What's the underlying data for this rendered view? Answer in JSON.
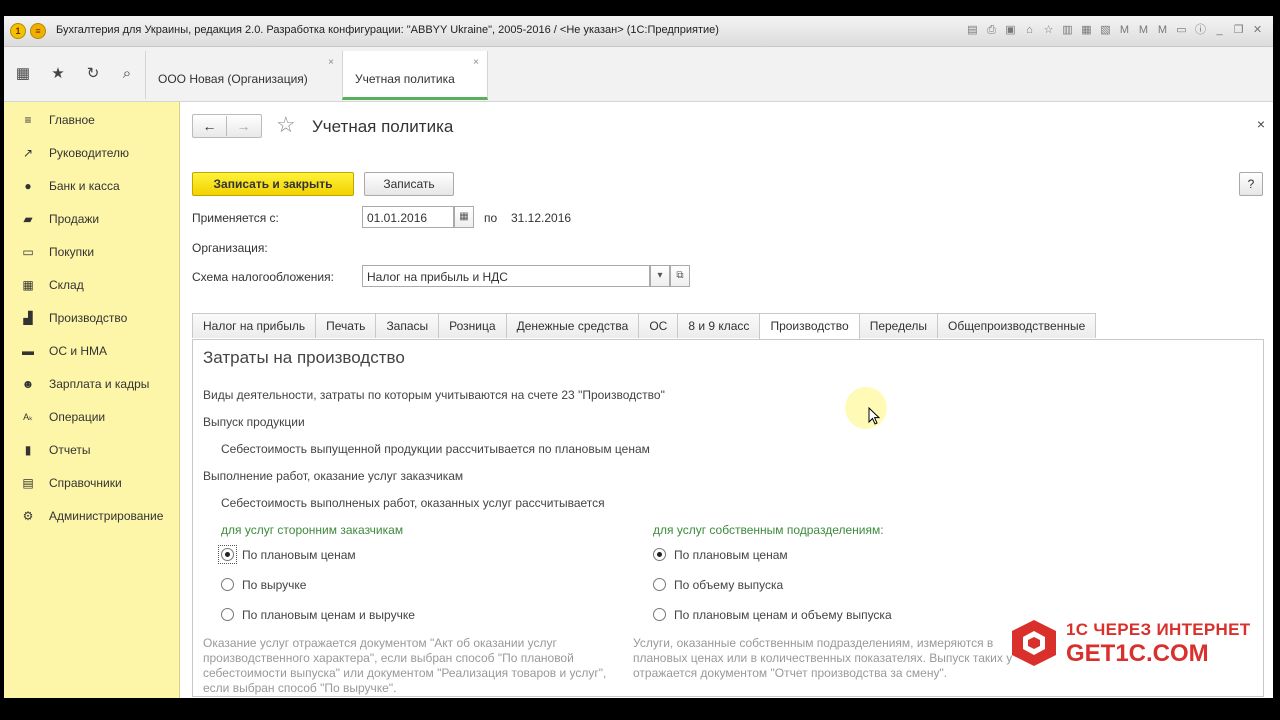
{
  "window": {
    "title": "Бухгалтерия для Украины, редакция 2.0. Разработка конфигурации: \"ABBYY Ukraine\", 2005-2016 / <Не указан>  (1С:Предприятие)"
  },
  "open_tabs": [
    {
      "label": "ООО Новая (Организация)",
      "close": "×"
    },
    {
      "label": "Учетная политика",
      "close": "×"
    }
  ],
  "sidebar": {
    "items": [
      {
        "label": "Главное",
        "icon": "≡"
      },
      {
        "label": "Руководителю",
        "icon": "↗"
      },
      {
        "label": "Банк и касса",
        "icon": "●"
      },
      {
        "label": "Продажи",
        "icon": "▰"
      },
      {
        "label": "Покупки",
        "icon": "▭"
      },
      {
        "label": "Склад",
        "icon": "▦"
      },
      {
        "label": "Производство",
        "icon": "▟"
      },
      {
        "label": "ОС и НМА",
        "icon": "▬"
      },
      {
        "label": "Зарплата и кадры",
        "icon": "☻"
      },
      {
        "label": "Операции",
        "icon": "Aₖ"
      },
      {
        "label": "Отчеты",
        "icon": "▮"
      },
      {
        "label": "Справочники",
        "icon": "▤"
      },
      {
        "label": "Администрирование",
        "icon": "⚙"
      }
    ]
  },
  "form": {
    "title": "Учетная политика",
    "save_close_label": "Записать и закрыть",
    "save_label": "Записать",
    "help_label": "?",
    "applies_label": "Применяется с:",
    "date_from": "01.01.2016",
    "to_label": "по",
    "date_to": "31.12.2016",
    "org_label": "Организация:",
    "tax_scheme_label": "Схема налогообложения:",
    "tax_scheme_value": "Налог на прибыль и НДС"
  },
  "tabs": [
    {
      "label": "Налог на прибыль",
      "active": false
    },
    {
      "label": "Печать",
      "active": false
    },
    {
      "label": "Запасы",
      "active": false
    },
    {
      "label": "Розница",
      "active": false
    },
    {
      "label": "Денежные средства",
      "active": false
    },
    {
      "label": "ОС",
      "active": false
    },
    {
      "label": "8 и 9 класс",
      "active": false
    },
    {
      "label": "Производство",
      "active": true
    },
    {
      "label": "Переделы",
      "active": false
    },
    {
      "label": "Общепроизводственные",
      "active": false
    }
  ],
  "panel": {
    "section_title": "Затраты на производство",
    "activities_text": "Виды деятельности, затраты по которым учитываются на счете 23 \"Производство\"",
    "output_label": "Выпуск продукции",
    "output_text": "Себестоимость выпущенной продукции рассчитывается по плановым ценам",
    "works_label": "Выполнение работ, оказание услуг заказчикам",
    "works_text": "Себестоимость выполненых работ, оказанных услуг рассчитывается",
    "external_title": "для услуг сторонним заказчикам",
    "internal_title": "для услуг собственным подразделениям:",
    "external_options": [
      {
        "label": "По плановым ценам",
        "selected": true
      },
      {
        "label": "По выручке",
        "selected": false
      },
      {
        "label": "По плановым ценам и выручке",
        "selected": false
      }
    ],
    "internal_options": [
      {
        "label": "По плановым ценам",
        "selected": true
      },
      {
        "label": "По объему выпуска",
        "selected": false
      },
      {
        "label": "По плановым ценам и объему выпуска",
        "selected": false
      }
    ],
    "external_note": [
      "Оказание услуг отражается документом \"Акт об оказании услуг",
      "производственного характера\", если выбран способ \"По плановой",
      "себестоимости выпуска\" или документом \"Реализация товаров и услуг\",",
      "если выбран способ \"По выручке\"."
    ],
    "internal_note": [
      "Услуги, оказанные собственным подразделениям, измеряются в",
      "плановых ценах или в количественных показателях. Выпуск таких у",
      "отражается документом \"Отчет производства за смену\"."
    ]
  },
  "watermark": {
    "line1": "1С ЧЕРЕЗ ИНТЕРНЕТ",
    "line2": "GET1C.COM",
    "color": "#d9302c"
  },
  "colors": {
    "sidebar_bg": "#fdf6a8",
    "primary_button": "#f2d200",
    "accent_green": "#3c8a3c"
  }
}
